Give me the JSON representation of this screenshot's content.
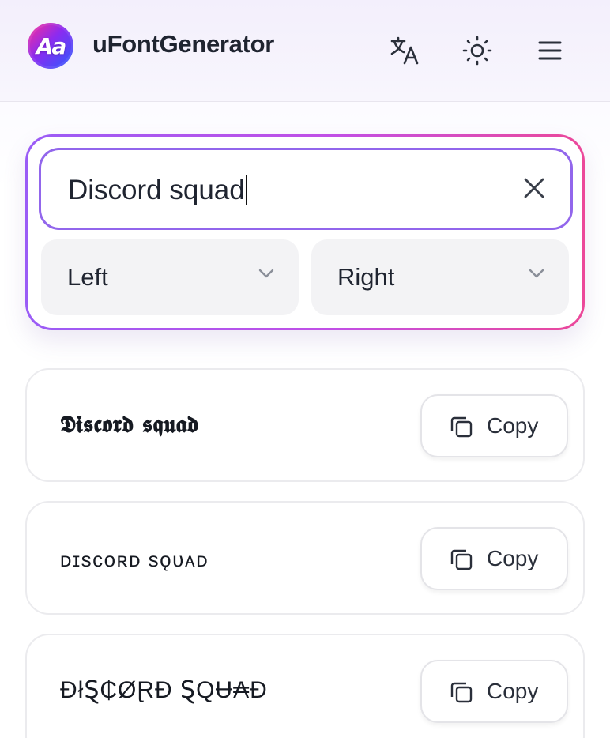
{
  "header": {
    "logo_text": "Aa",
    "brand": "uFontGenerator",
    "icons": {
      "translate": "translate-icon",
      "theme": "sun-icon",
      "menu": "hamburger-menu-icon"
    }
  },
  "input": {
    "value": "Discord squad",
    "clear_icon": "close-icon"
  },
  "selects": {
    "left": {
      "selected": "Left",
      "icon": "chevron-down-icon"
    },
    "right": {
      "selected": "Right",
      "icon": "chevron-down-icon"
    }
  },
  "results": [
    {
      "text": "𝕯𝖎𝖘𝖈𝖔𝖗𝖉 𝖘𝖖𝖚𝖆𝖉",
      "copy_label": "Copy"
    },
    {
      "text": "ᴅɪsᴄᴏʀᴅ sǫᴜᴀᴅ",
      "copy_label": "Copy"
    },
    {
      "text": "ĐłⱾ₵ØⱤĐ ⱾQɄ₳Đ",
      "copy_label": "Copy"
    }
  ],
  "colors": {
    "accent_purple": "#9266ec",
    "accent_pink": "#ec4899",
    "select_bg": "#f3f3f5"
  }
}
